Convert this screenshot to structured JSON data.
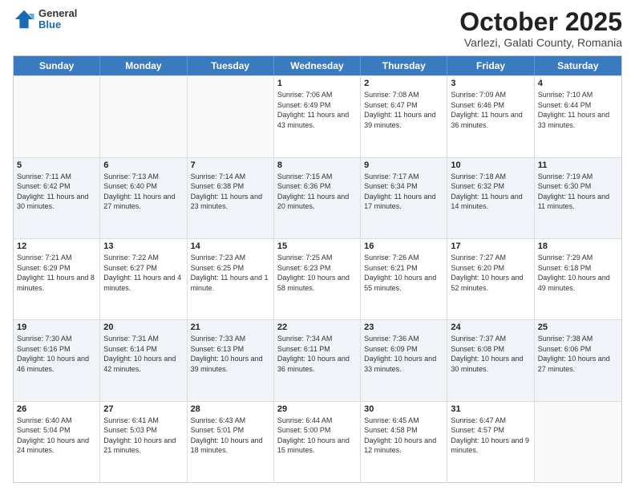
{
  "header": {
    "logo": {
      "line1": "General",
      "line2": "Blue"
    },
    "title": "October 2025",
    "subtitle": "Varlezi, Galati County, Romania"
  },
  "calendar": {
    "days": [
      "Sunday",
      "Monday",
      "Tuesday",
      "Wednesday",
      "Thursday",
      "Friday",
      "Saturday"
    ],
    "rows": [
      [
        {
          "day": "",
          "info": ""
        },
        {
          "day": "",
          "info": ""
        },
        {
          "day": "",
          "info": ""
        },
        {
          "day": "1",
          "info": "Sunrise: 7:06 AM\nSunset: 6:49 PM\nDaylight: 11 hours and 43 minutes."
        },
        {
          "day": "2",
          "info": "Sunrise: 7:08 AM\nSunset: 6:47 PM\nDaylight: 11 hours and 39 minutes."
        },
        {
          "day": "3",
          "info": "Sunrise: 7:09 AM\nSunset: 6:46 PM\nDaylight: 11 hours and 36 minutes."
        },
        {
          "day": "4",
          "info": "Sunrise: 7:10 AM\nSunset: 6:44 PM\nDaylight: 11 hours and 33 minutes."
        }
      ],
      [
        {
          "day": "5",
          "info": "Sunrise: 7:11 AM\nSunset: 6:42 PM\nDaylight: 11 hours and 30 minutes."
        },
        {
          "day": "6",
          "info": "Sunrise: 7:13 AM\nSunset: 6:40 PM\nDaylight: 11 hours and 27 minutes."
        },
        {
          "day": "7",
          "info": "Sunrise: 7:14 AM\nSunset: 6:38 PM\nDaylight: 11 hours and 23 minutes."
        },
        {
          "day": "8",
          "info": "Sunrise: 7:15 AM\nSunset: 6:36 PM\nDaylight: 11 hours and 20 minutes."
        },
        {
          "day": "9",
          "info": "Sunrise: 7:17 AM\nSunset: 6:34 PM\nDaylight: 11 hours and 17 minutes."
        },
        {
          "day": "10",
          "info": "Sunrise: 7:18 AM\nSunset: 6:32 PM\nDaylight: 11 hours and 14 minutes."
        },
        {
          "day": "11",
          "info": "Sunrise: 7:19 AM\nSunset: 6:30 PM\nDaylight: 11 hours and 11 minutes."
        }
      ],
      [
        {
          "day": "12",
          "info": "Sunrise: 7:21 AM\nSunset: 6:29 PM\nDaylight: 11 hours and 8 minutes."
        },
        {
          "day": "13",
          "info": "Sunrise: 7:22 AM\nSunset: 6:27 PM\nDaylight: 11 hours and 4 minutes."
        },
        {
          "day": "14",
          "info": "Sunrise: 7:23 AM\nSunset: 6:25 PM\nDaylight: 11 hours and 1 minute."
        },
        {
          "day": "15",
          "info": "Sunrise: 7:25 AM\nSunset: 6:23 PM\nDaylight: 10 hours and 58 minutes."
        },
        {
          "day": "16",
          "info": "Sunrise: 7:26 AM\nSunset: 6:21 PM\nDaylight: 10 hours and 55 minutes."
        },
        {
          "day": "17",
          "info": "Sunrise: 7:27 AM\nSunset: 6:20 PM\nDaylight: 10 hours and 52 minutes."
        },
        {
          "day": "18",
          "info": "Sunrise: 7:29 AM\nSunset: 6:18 PM\nDaylight: 10 hours and 49 minutes."
        }
      ],
      [
        {
          "day": "19",
          "info": "Sunrise: 7:30 AM\nSunset: 6:16 PM\nDaylight: 10 hours and 46 minutes."
        },
        {
          "day": "20",
          "info": "Sunrise: 7:31 AM\nSunset: 6:14 PM\nDaylight: 10 hours and 42 minutes."
        },
        {
          "day": "21",
          "info": "Sunrise: 7:33 AM\nSunset: 6:13 PM\nDaylight: 10 hours and 39 minutes."
        },
        {
          "day": "22",
          "info": "Sunrise: 7:34 AM\nSunset: 6:11 PM\nDaylight: 10 hours and 36 minutes."
        },
        {
          "day": "23",
          "info": "Sunrise: 7:36 AM\nSunset: 6:09 PM\nDaylight: 10 hours and 33 minutes."
        },
        {
          "day": "24",
          "info": "Sunrise: 7:37 AM\nSunset: 6:08 PM\nDaylight: 10 hours and 30 minutes."
        },
        {
          "day": "25",
          "info": "Sunrise: 7:38 AM\nSunset: 6:06 PM\nDaylight: 10 hours and 27 minutes."
        }
      ],
      [
        {
          "day": "26",
          "info": "Sunrise: 6:40 AM\nSunset: 5:04 PM\nDaylight: 10 hours and 24 minutes."
        },
        {
          "day": "27",
          "info": "Sunrise: 6:41 AM\nSunset: 5:03 PM\nDaylight: 10 hours and 21 minutes."
        },
        {
          "day": "28",
          "info": "Sunrise: 6:43 AM\nSunset: 5:01 PM\nDaylight: 10 hours and 18 minutes."
        },
        {
          "day": "29",
          "info": "Sunrise: 6:44 AM\nSunset: 5:00 PM\nDaylight: 10 hours and 15 minutes."
        },
        {
          "day": "30",
          "info": "Sunrise: 6:45 AM\nSunset: 4:58 PM\nDaylight: 10 hours and 12 minutes."
        },
        {
          "day": "31",
          "info": "Sunrise: 6:47 AM\nSunset: 4:57 PM\nDaylight: 10 hours and 9 minutes."
        },
        {
          "day": "",
          "info": ""
        }
      ]
    ]
  }
}
